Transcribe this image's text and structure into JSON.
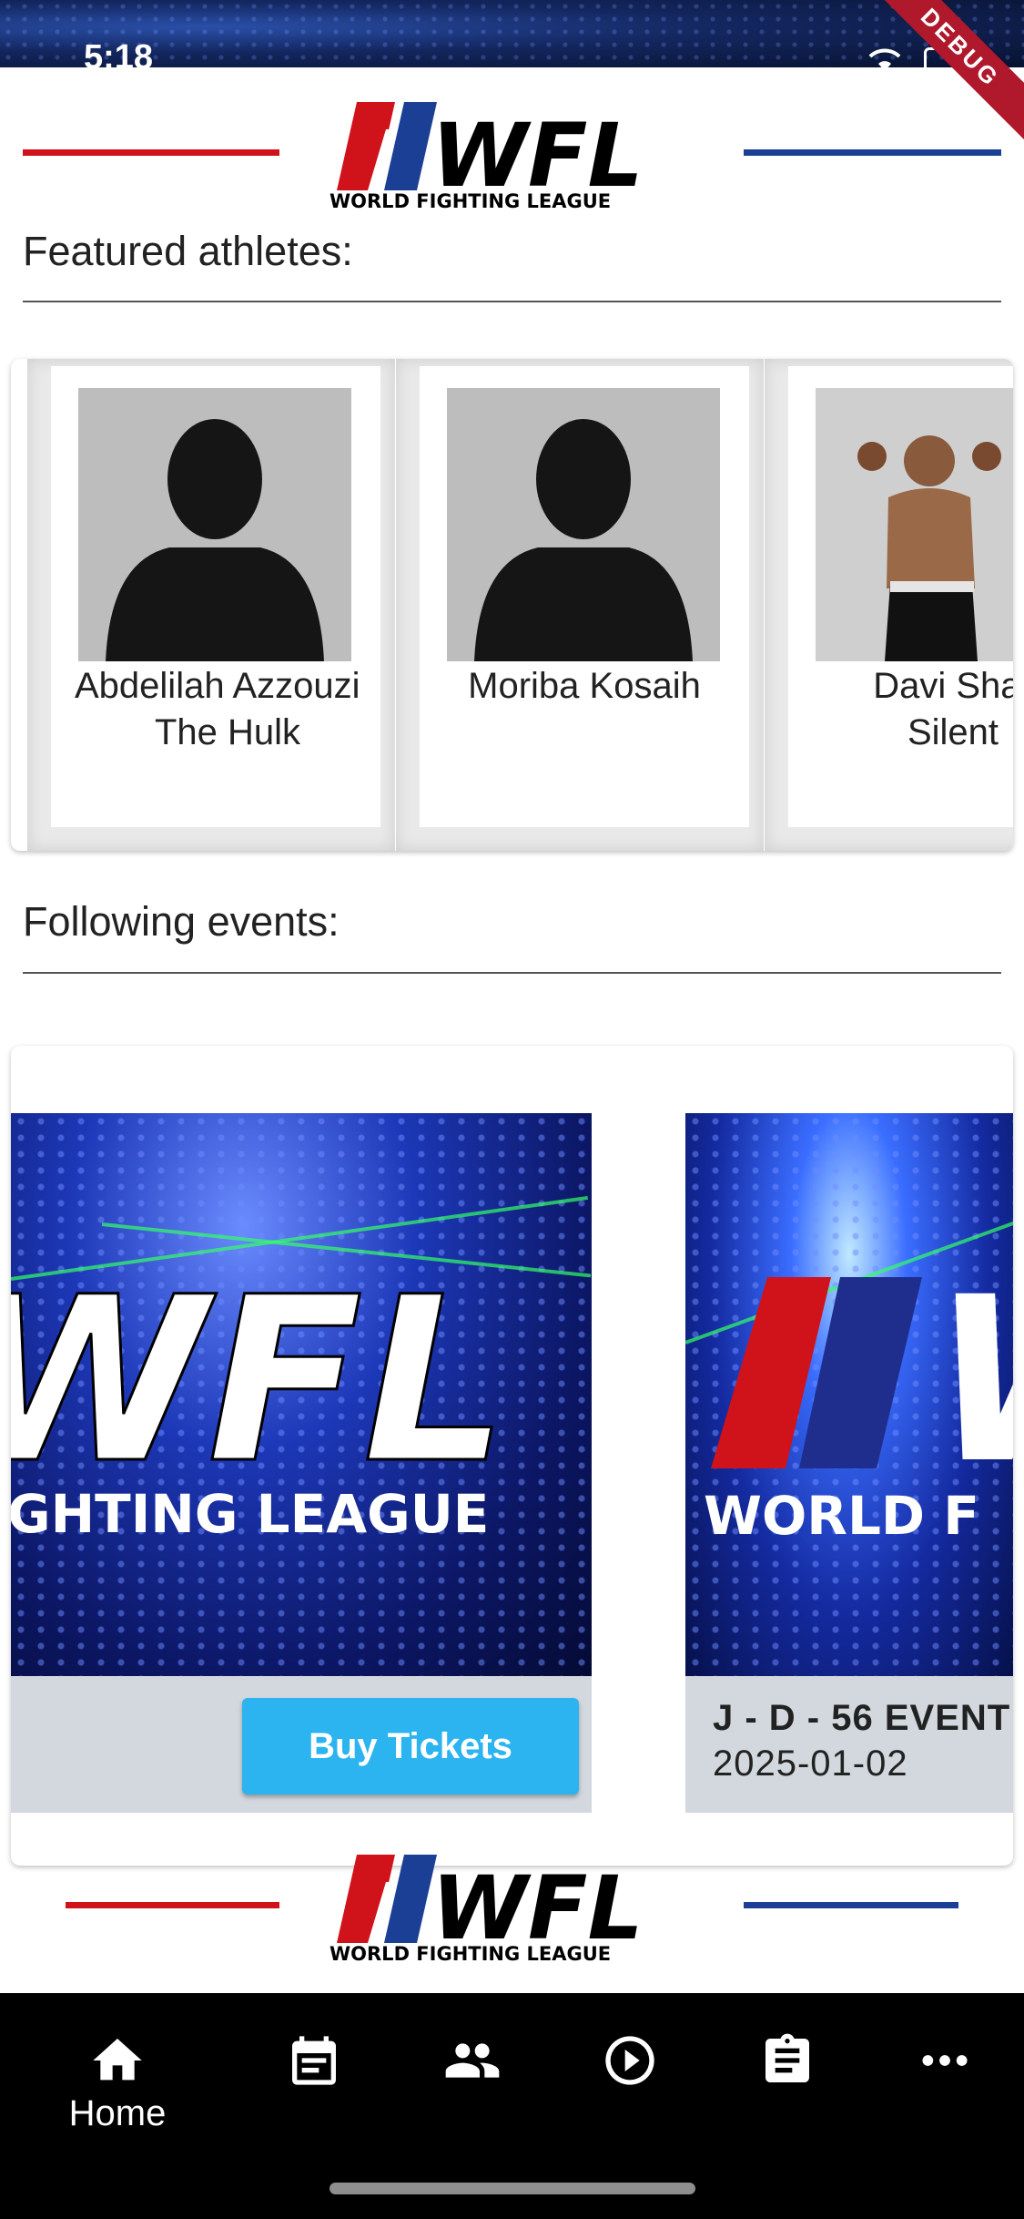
{
  "status_bar": {
    "time": "5:18",
    "debug_label": "DEBUG"
  },
  "header": {
    "logo_text": "WFL",
    "logo_subtitle": "WORLD FIGHTING LEAGUE"
  },
  "athletes_section": {
    "title": "Featured athletes:",
    "athletes": [
      {
        "name": "Abdelilah Azzouzi",
        "nickname": "The Hulk"
      },
      {
        "name": "Moriba Kosaih",
        "nickname": ""
      },
      {
        "name": "Davi Shar",
        "nickname": "Silent"
      }
    ]
  },
  "events_section": {
    "title": "Following events:",
    "events": [
      {
        "banner_text": "GHTING LEAGUE",
        "button_label": "Buy Tickets"
      },
      {
        "banner_text": "WORLD F",
        "title": "J - D - 56 EVENT",
        "date": "2025-01-02"
      }
    ]
  },
  "footer": {
    "logo_text": "WFL",
    "logo_subtitle": "WORLD FIGHTING LEAGUE"
  },
  "bottom_nav": {
    "items": [
      {
        "icon": "home-icon",
        "label": "Home",
        "active": true
      },
      {
        "icon": "calendar-icon",
        "label": "",
        "active": false
      },
      {
        "icon": "people-icon",
        "label": "",
        "active": false
      },
      {
        "icon": "play-icon",
        "label": "",
        "active": false
      },
      {
        "icon": "clipboard-icon",
        "label": "",
        "active": false
      },
      {
        "icon": "more-icon",
        "label": "",
        "active": false
      }
    ]
  },
  "colors": {
    "brand_red": "#d0121b",
    "brand_blue": "#1b3f94",
    "button_blue": "#2bb4ef"
  }
}
